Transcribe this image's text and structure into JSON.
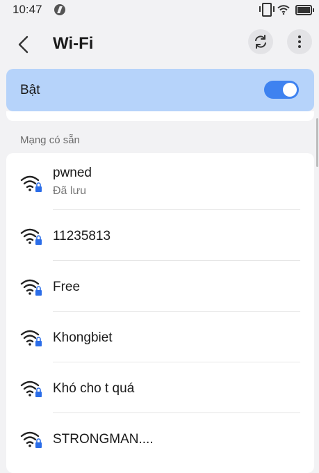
{
  "status_bar": {
    "time": "10:47"
  },
  "app_bar": {
    "title": "Wi-Fi"
  },
  "wifi_toggle": {
    "label": "Bật",
    "enabled": true
  },
  "available_section": {
    "label": "Mạng có sẵn"
  },
  "networks": [
    {
      "name": "pwned",
      "status": "Đã lưu",
      "secured": true
    },
    {
      "name": "11235813",
      "secured": true
    },
    {
      "name": "Free",
      "secured": true
    },
    {
      "name": "Khongbiet",
      "secured": true
    },
    {
      "name": "Khó cho t quá",
      "secured": true
    },
    {
      "name": "STRONGMAN....",
      "secured": true
    }
  ],
  "colors": {
    "toggle_card": "#b6d3fa",
    "switch_on": "#3e82f0",
    "lock": "#2b6de8"
  }
}
